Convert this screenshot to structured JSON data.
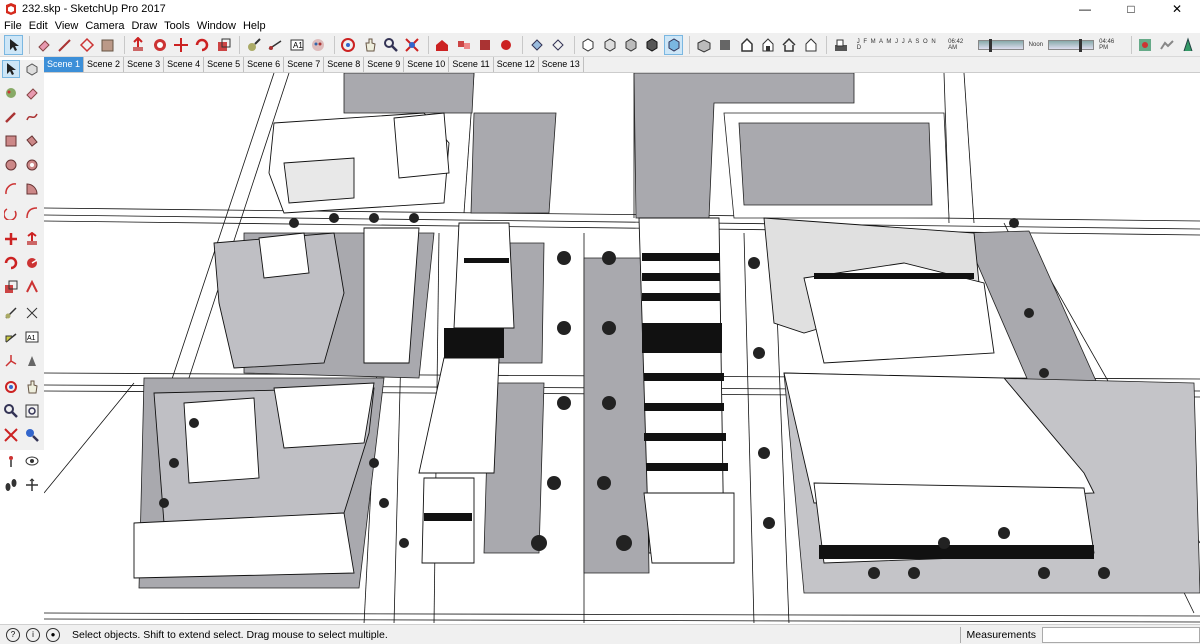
{
  "window": {
    "title": "232.skp - SketchUp Pro 2017"
  },
  "menu": [
    "File",
    "Edit",
    "View",
    "Camera",
    "Draw",
    "Tools",
    "Window",
    "Help"
  ],
  "scenes": [
    "Scene 1",
    "Scene 2",
    "Scene 3",
    "Scene 4",
    "Scene 5",
    "Scene 6",
    "Scene 7",
    "Scene 8",
    "Scene 9",
    "Scene 10",
    "Scene 11",
    "Scene 12",
    "Scene 13"
  ],
  "active_scene": "Scene 1",
  "shadows": {
    "months": "J F M A M J J A S O N D",
    "time_start": "06:42 AM",
    "time_mid": "Noon",
    "time_end": "04:46 PM"
  },
  "status": {
    "message": "Select objects. Shift to extend select. Drag mouse to select multiple.",
    "measurements_label": "Measurements",
    "measurements_value": ""
  },
  "colors": {
    "accent": "#3c8fd8",
    "ground": "#a9a9ae",
    "background": "#ffffff"
  }
}
